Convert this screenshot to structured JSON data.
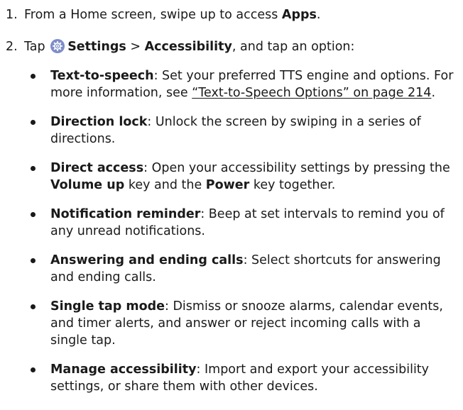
{
  "steps": [
    {
      "number": "1.",
      "text_before": "From a Home screen, swipe up to access ",
      "bold": "Apps",
      "text_after": "."
    },
    {
      "number": "2.",
      "tap": "Tap ",
      "icon": "settings-gear-icon",
      "settings": "Settings",
      "separator": " > ",
      "accessibility": "Accessibility",
      "text_after": ", and tap an option:"
    }
  ],
  "options": [
    {
      "term": "Text-to-speech",
      "desc": ": Set your preferred TTS engine and options. For more information, see ",
      "link": "“Text-to-Speech Options” on page 214",
      "after": "."
    },
    {
      "term": "Direction lock",
      "desc": ": Unlock the screen by swiping in a series of directions."
    },
    {
      "term": "Direct access",
      "desc": ": Open your accessibility settings by pressing the ",
      "bold1": "Volume up",
      "mid": " key and the ",
      "bold2": "Power",
      "after": " key together."
    },
    {
      "term": "Notification reminder",
      "desc": ": Beep at set intervals to remind you of any unread notifications."
    },
    {
      "term": "Answering and ending calls",
      "desc": ": Select shortcuts for answering and ending calls."
    },
    {
      "term": "Single tap mode",
      "desc": ": Dismiss or snooze alarms, calendar events, and timer alerts, and answer or reject incoming calls with a single tap."
    },
    {
      "term": "Manage accessibility",
      "desc": ": Import and export your accessibility settings, or share them with other devices."
    }
  ],
  "colors": {
    "settings_icon_bg": "#7d8dc8",
    "text": "#1a1a1a"
  }
}
